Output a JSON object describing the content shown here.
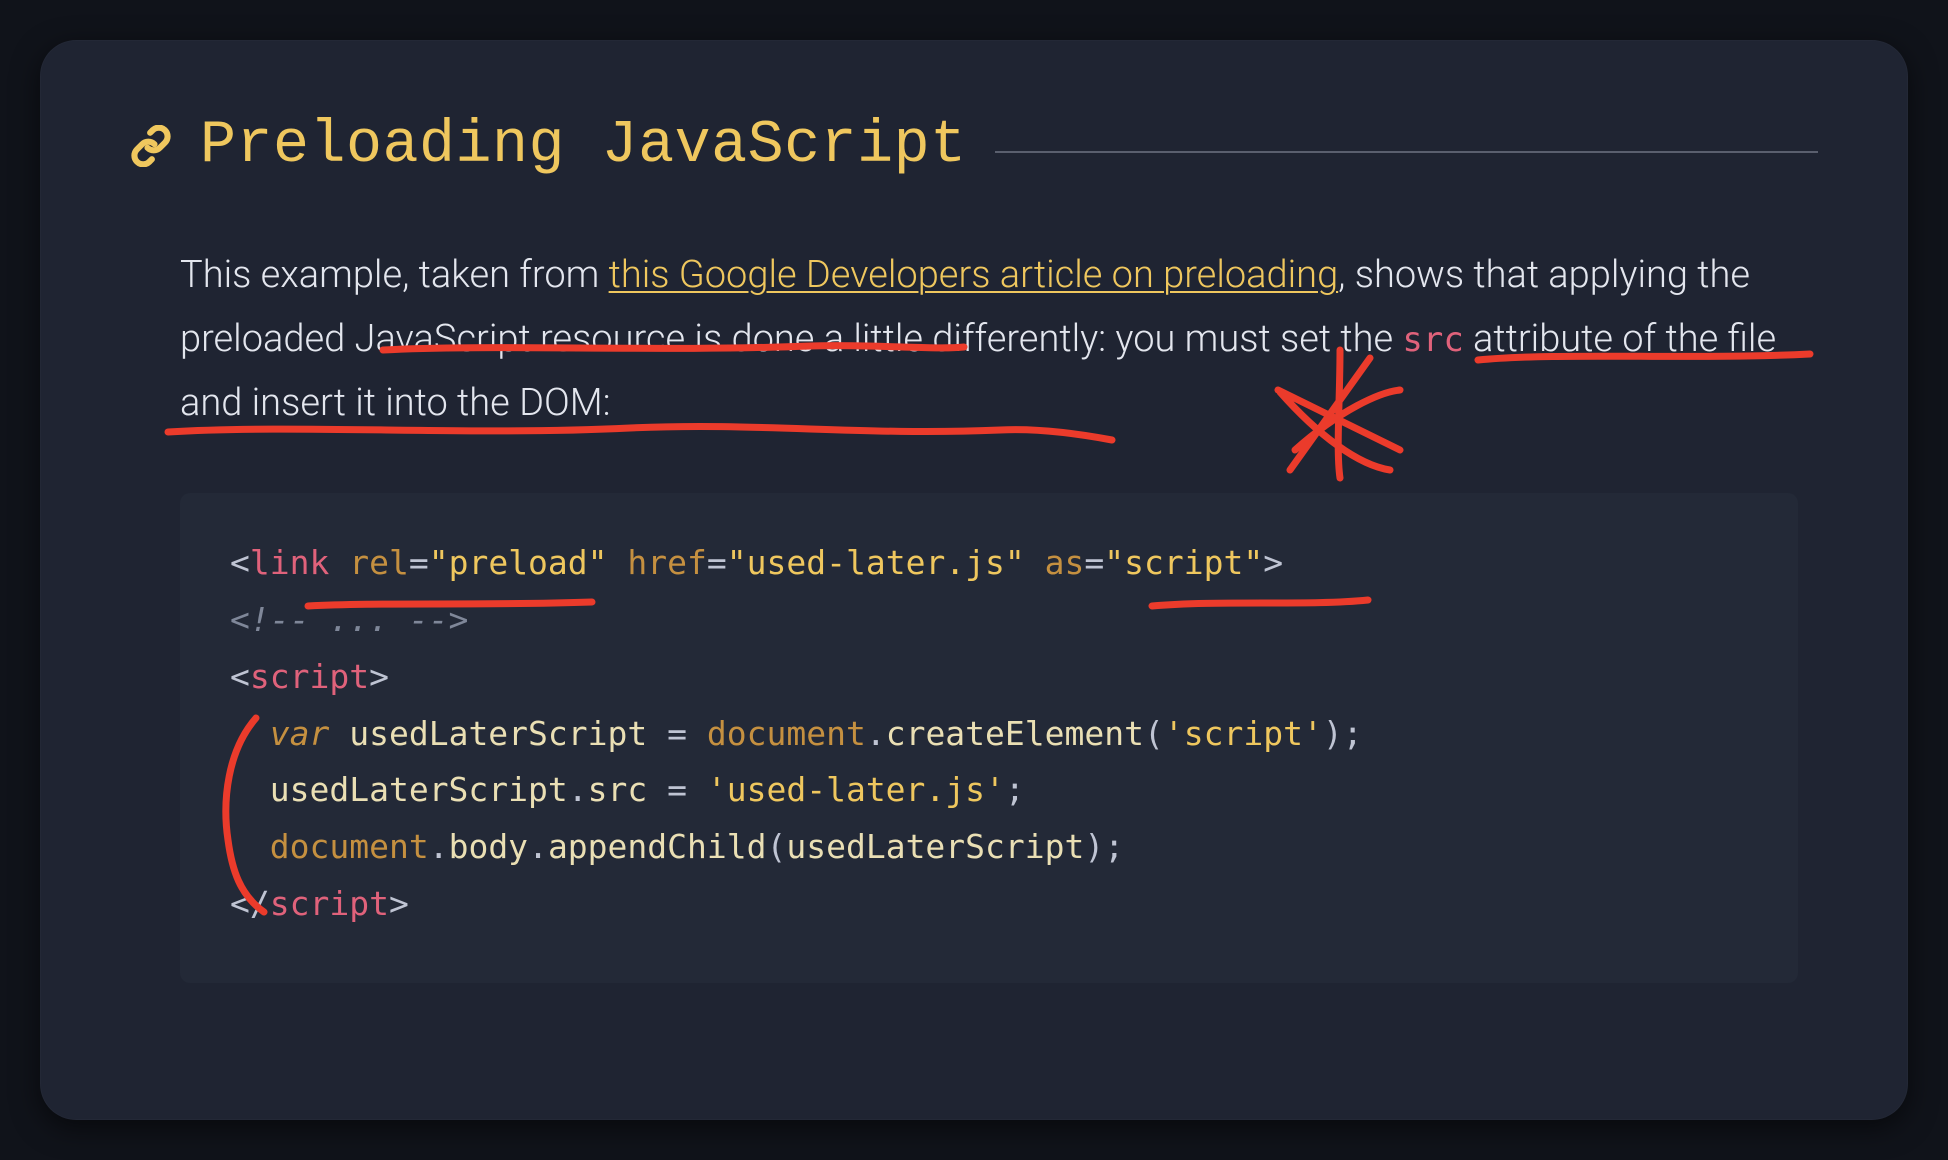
{
  "heading": {
    "title": "Preloading JavaScript"
  },
  "paragraph": {
    "before_link": "This example, taken from ",
    "link_text": "this Google Developers article on preloading",
    "after_link_1": ", shows that applying the preloaded JavaScript resource is done a little differently: you must set the ",
    "inline_code": "src",
    "after_code": " attribute of the file and insert it into the DOM:"
  },
  "code": {
    "l1": {
      "open": "<",
      "tag": "link",
      "sp1": " ",
      "attr1": "rel",
      "eq1": "=",
      "val1": "\"preload\"",
      "sp2": " ",
      "attr2": "href",
      "eq2": "=",
      "val2": "\"used-later.js\"",
      "sp3": " ",
      "attr3": "as",
      "eq3": "=",
      "val3": "\"script\"",
      "close": ">"
    },
    "l2": {
      "comment": "<!-- ... -->"
    },
    "l3": {
      "open": "<",
      "tag": "script",
      "close": ">"
    },
    "l4": {
      "indent": "  ",
      "kw": "var",
      "sp1": " ",
      "id": "usedLaterScript",
      "sp2": " ",
      "eq": "=",
      "sp3": " ",
      "obj": "document",
      "dot": ".",
      "fn": "createElement",
      "lp": "(",
      "arg": "'script'",
      "rp": ")",
      "semi": ";"
    },
    "l5": {
      "indent": "  ",
      "id": "usedLaterScript",
      "dot1": ".",
      "prop": "src",
      "sp1": " ",
      "eq": "=",
      "sp2": " ",
      "str": "'used-later.js'",
      "semi": ";"
    },
    "l6": {
      "indent": "  ",
      "obj": "document",
      "dot1": ".",
      "prop": "body",
      "dot2": ".",
      "fn": "appendChild",
      "lp": "(",
      "arg": "usedLaterScript",
      "rp": ")",
      "semi": ";"
    },
    "l7": {
      "open": "</",
      "tag": "script",
      "close": ">"
    }
  },
  "annotations": [
    {
      "name": "underline-preloaded-js-resource"
    },
    {
      "name": "underline-you-must-set"
    },
    {
      "name": "underline-src-attribute-sentence"
    },
    {
      "name": "star-doodle"
    },
    {
      "name": "underline-rel-preload"
    },
    {
      "name": "underline-as-script"
    },
    {
      "name": "bracket-script-body"
    }
  ]
}
